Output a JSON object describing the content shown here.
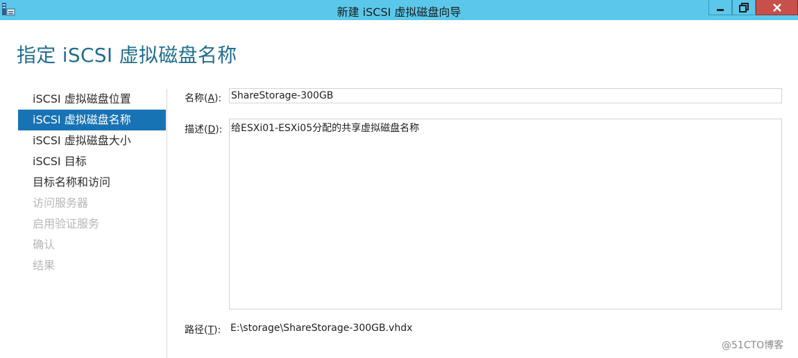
{
  "window": {
    "title": "新建 iSCSI 虚拟磁盘向导",
    "app_icon": "server-wizard-icon",
    "controls": [
      "minimize-icon",
      "restore-icon",
      "close-icon"
    ]
  },
  "page": {
    "heading": "指定 iSCSI 虚拟磁盘名称"
  },
  "nav": {
    "items": [
      {
        "label": "iSCSI 虚拟磁盘位置",
        "state": "normal"
      },
      {
        "label": "iSCSI 虚拟磁盘名称",
        "state": "active"
      },
      {
        "label": "iSCSI 虚拟磁盘大小",
        "state": "normal"
      },
      {
        "label": "iSCSI 目标",
        "state": "normal"
      },
      {
        "label": "目标名称和访问",
        "state": "normal"
      },
      {
        "label": "访问服务器",
        "state": "disabled"
      },
      {
        "label": "启用验证服务",
        "state": "disabled"
      },
      {
        "label": "确认",
        "state": "disabled"
      },
      {
        "label": "结果",
        "state": "disabled"
      }
    ]
  },
  "form": {
    "name": {
      "label_prefix": "名称(",
      "access_key": "A",
      "label_suffix": "):",
      "value": "ShareStorage-300GB"
    },
    "description": {
      "label_prefix": "描述(",
      "access_key": "D",
      "label_suffix": "):",
      "value": "给ESXi01-ESXi05分配的共享虚拟磁盘名称"
    },
    "path": {
      "label_prefix": "路径(",
      "access_key": "T",
      "label_suffix": "):",
      "value": "E:\\storage\\ShareStorage-300GB.vhdx"
    }
  },
  "watermark": "@51CTO博客",
  "colors": {
    "titlebar": "#5bc8eb",
    "heading": "#1f6e8d",
    "active_nav": "#1873b5",
    "close_button": "#c7504b",
    "disabled_text": "#b6b6b6"
  }
}
